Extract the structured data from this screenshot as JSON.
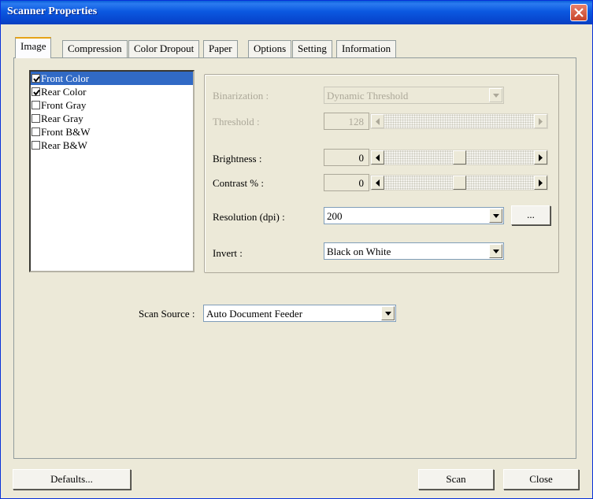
{
  "window": {
    "title": "Scanner Properties"
  },
  "tabs": [
    {
      "label": "Image"
    },
    {
      "label": "Compression"
    },
    {
      "label": "Color Dropout"
    },
    {
      "label": "Paper"
    },
    {
      "label": "Options"
    },
    {
      "label": "Setting"
    },
    {
      "label": "Information"
    }
  ],
  "image_types": [
    {
      "label": "Front Color",
      "checked": true
    },
    {
      "label": "Rear Color",
      "checked": true
    },
    {
      "label": "Front Gray",
      "checked": false
    },
    {
      "label": "Rear Gray",
      "checked": false
    },
    {
      "label": "Front B&W",
      "checked": false
    },
    {
      "label": "Rear B&W",
      "checked": false
    }
  ],
  "settings": {
    "binarization_label": "Binarization :",
    "binarization_value": "Dynamic Threshold",
    "threshold_label": "Threshold :",
    "threshold_value": "128",
    "brightness_label": "Brightness :",
    "brightness_value": "0",
    "contrast_label": "Contrast % :",
    "contrast_value": "0",
    "resolution_label": "Resolution (dpi) :",
    "resolution_value": "200",
    "more_label": "...",
    "invert_label": "Invert :",
    "invert_value": "Black on White"
  },
  "scan_source": {
    "label": "Scan Source :",
    "value": "Auto Document Feeder"
  },
  "buttons": {
    "defaults": "Defaults...",
    "scan": "Scan",
    "close": "Close"
  },
  "icons": {
    "close": "close-x-icon",
    "dropdown": "triangle-down-icon",
    "scroll_left": "triangle-left-icon",
    "scroll_right": "triangle-right-icon",
    "check": "check-mark-icon"
  },
  "colors": {
    "titlebar": "#0a5fd8",
    "selection": "#316ac5",
    "close_button": "#c8442a",
    "active_tab_accent": "#e6a317"
  }
}
